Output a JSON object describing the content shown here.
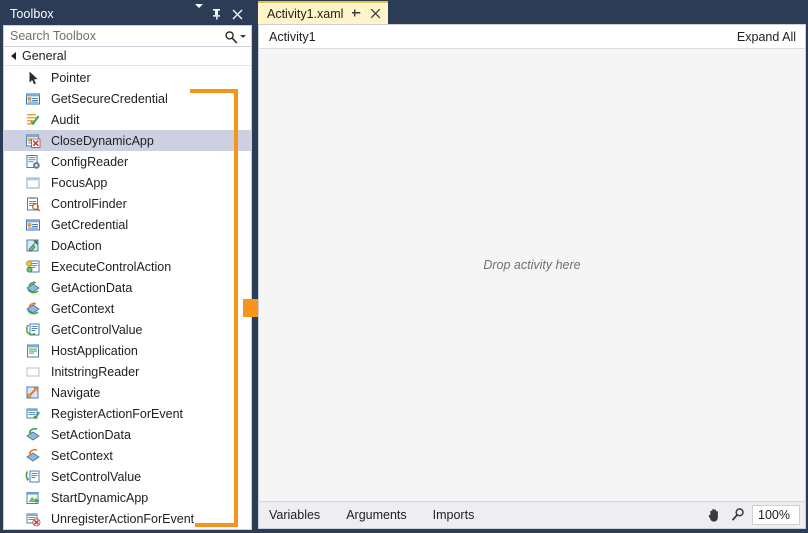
{
  "toolbox": {
    "title": "Toolbox",
    "header_icons": [
      {
        "name": "chevron-down-icon",
        "label": "▾"
      },
      {
        "name": "pin-icon",
        "label": "⟂"
      },
      {
        "name": "close-icon",
        "label": "✕"
      }
    ],
    "search": {
      "placeholder": "Search Toolbox",
      "value": "",
      "icon": "search-icon",
      "dropdown_icon": "chevron-down-icon"
    },
    "group": {
      "label": "General",
      "expanded": true
    },
    "items": [
      {
        "label": "Pointer",
        "icon": "pointer-icon",
        "selected": false
      },
      {
        "label": "GetSecureCredential",
        "icon": "credential-form-icon",
        "selected": false
      },
      {
        "label": "Audit",
        "icon": "checklist-check-icon",
        "selected": false
      },
      {
        "label": "CloseDynamicApp",
        "icon": "window-close-icon",
        "selected": true
      },
      {
        "label": "ConfigReader",
        "icon": "document-gear-icon",
        "selected": false
      },
      {
        "label": "FocusApp",
        "icon": "window-icon",
        "selected": false
      },
      {
        "label": "ControlFinder",
        "icon": "clipboard-search-icon",
        "selected": false
      },
      {
        "label": "GetCredential",
        "icon": "credential-form-icon",
        "selected": false
      },
      {
        "label": "DoAction",
        "icon": "action-arrow-icon",
        "selected": false
      },
      {
        "label": "ExecuteControlAction",
        "icon": "control-action-icon",
        "selected": false
      },
      {
        "label": "GetActionData",
        "icon": "get-data-icon",
        "selected": false
      },
      {
        "label": "GetContext",
        "icon": "get-context-icon",
        "selected": false
      },
      {
        "label": "GetControlValue",
        "icon": "get-control-value-icon",
        "selected": false
      },
      {
        "label": "HostApplication",
        "icon": "host-app-icon",
        "selected": false
      },
      {
        "label": "InitstringReader",
        "icon": "blank-rect-icon",
        "selected": false
      },
      {
        "label": "Navigate",
        "icon": "navigate-icon",
        "selected": false
      },
      {
        "label": "RegisterActionForEvent",
        "icon": "register-event-icon",
        "selected": false
      },
      {
        "label": "SetActionData",
        "icon": "set-data-icon",
        "selected": false
      },
      {
        "label": "SetContext",
        "icon": "set-context-icon",
        "selected": false
      },
      {
        "label": "SetControlValue",
        "icon": "set-control-value-icon",
        "selected": false
      },
      {
        "label": "StartDynamicApp",
        "icon": "start-app-icon",
        "selected": false
      },
      {
        "label": "UnregisterActionForEvent",
        "icon": "unregister-event-icon",
        "selected": false
      }
    ]
  },
  "annotations": {
    "bracket_color": "#f7941e",
    "arrow_color": "#f7941e",
    "arrow_name": "orange-arrow"
  },
  "editor": {
    "tab": {
      "label": "Activity1.xaml",
      "pin_icon": "pin-icon",
      "close_icon": "close-icon"
    },
    "breadcrumb": "Activity1",
    "expand_all": "Expand All",
    "canvas": {
      "drop_hint": "Drop activity here"
    },
    "footer": {
      "links": [
        "Variables",
        "Arguments",
        "Imports"
      ],
      "pan_icon": "hand-pan-icon",
      "zoom_icon": "magnifier-zoom-icon",
      "zoom_value": "100%"
    }
  },
  "colors": {
    "chrome": "#2d3c56",
    "tab_active": "#fff5c9",
    "tab_accent": "#e3c150",
    "selection": "#cdd0e1",
    "accent_orange": "#f7941e"
  }
}
